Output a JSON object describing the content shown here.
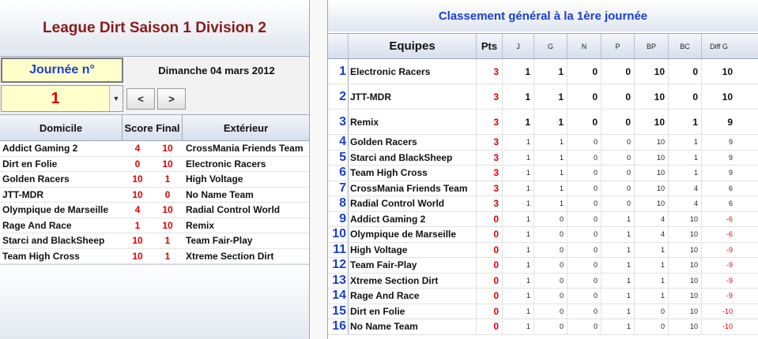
{
  "left": {
    "title": "League Dirt Saison 1 Division 2",
    "journee_label": "Journée n°",
    "date": "Dimanche 04 mars 2012",
    "journee_value": "1",
    "prev_label": "<",
    "next_label": ">",
    "headers": {
      "home": "Domicile",
      "score": "Score Final",
      "away": "Extérieur"
    },
    "matches": [
      {
        "home": "Addict Gaming 2",
        "s1": "4",
        "s2": "10",
        "away": "CrossMania Friends Team"
      },
      {
        "home": "Dirt en Folie",
        "s1": "0",
        "s2": "10",
        "away": "Electronic Racers"
      },
      {
        "home": "Golden Racers",
        "s1": "10",
        "s2": "1",
        "away": "High Voltage"
      },
      {
        "home": "JTT-MDR",
        "s1": "10",
        "s2": "0",
        "away": "No Name Team"
      },
      {
        "home": "Olympique de Marseille",
        "s1": "4",
        "s2": "10",
        "away": "Radial Control World"
      },
      {
        "home": "Rage And Race",
        "s1": "1",
        "s2": "10",
        "away": "Remix"
      },
      {
        "home": "Starci and BlackSheep",
        "s1": "10",
        "s2": "1",
        "away": "Team Fair-Play"
      },
      {
        "home": "Team High Cross",
        "s1": "10",
        "s2": "1",
        "away": "Xtreme Section Dirt"
      }
    ]
  },
  "right": {
    "title": "Classement général à la 1ère journée",
    "headers": {
      "team": "Equipes",
      "pts": "Pts",
      "j": "J",
      "g": "G",
      "n": "N",
      "p": "P",
      "bp": "BP",
      "bc": "BC",
      "diff": "Diff G"
    },
    "rows": [
      {
        "rank": "1",
        "team": "Electronic Racers",
        "pts": "3",
        "j": "1",
        "g": "1",
        "n": "0",
        "p": "0",
        "bp": "10",
        "bc": "0",
        "diff": "10"
      },
      {
        "rank": "2",
        "team": "JTT-MDR",
        "pts": "3",
        "j": "1",
        "g": "1",
        "n": "0",
        "p": "0",
        "bp": "10",
        "bc": "0",
        "diff": "10"
      },
      {
        "rank": "3",
        "team": "Remix",
        "pts": "3",
        "j": "1",
        "g": "1",
        "n": "0",
        "p": "0",
        "bp": "10",
        "bc": "1",
        "diff": "9"
      },
      {
        "rank": "4",
        "team": "Golden Racers",
        "pts": "3",
        "j": "1",
        "g": "1",
        "n": "0",
        "p": "0",
        "bp": "10",
        "bc": "1",
        "diff": "9"
      },
      {
        "rank": "5",
        "team": "Starci and BlackSheep",
        "pts": "3",
        "j": "1",
        "g": "1",
        "n": "0",
        "p": "0",
        "bp": "10",
        "bc": "1",
        "diff": "9"
      },
      {
        "rank": "6",
        "team": "Team High Cross",
        "pts": "3",
        "j": "1",
        "g": "1",
        "n": "0",
        "p": "0",
        "bp": "10",
        "bc": "1",
        "diff": "9"
      },
      {
        "rank": "7",
        "team": "CrossMania Friends Team",
        "pts": "3",
        "j": "1",
        "g": "1",
        "n": "0",
        "p": "0",
        "bp": "10",
        "bc": "4",
        "diff": "6"
      },
      {
        "rank": "8",
        "team": "Radial Control World",
        "pts": "3",
        "j": "1",
        "g": "1",
        "n": "0",
        "p": "0",
        "bp": "10",
        "bc": "4",
        "diff": "6"
      },
      {
        "rank": "9",
        "team": "Addict Gaming 2",
        "pts": "0",
        "j": "1",
        "g": "0",
        "n": "0",
        "p": "1",
        "bp": "4",
        "bc": "10",
        "diff": "-6"
      },
      {
        "rank": "10",
        "team": "Olympique de Marseille",
        "pts": "0",
        "j": "1",
        "g": "0",
        "n": "0",
        "p": "1",
        "bp": "4",
        "bc": "10",
        "diff": "-6"
      },
      {
        "rank": "11",
        "team": "High Voltage",
        "pts": "0",
        "j": "1",
        "g": "0",
        "n": "0",
        "p": "1",
        "bp": "1",
        "bc": "10",
        "diff": "-9"
      },
      {
        "rank": "12",
        "team": "Team Fair-Play",
        "pts": "0",
        "j": "1",
        "g": "0",
        "n": "0",
        "p": "1",
        "bp": "1",
        "bc": "10",
        "diff": "-9"
      },
      {
        "rank": "13",
        "team": "Xtreme Section Dirt",
        "pts": "0",
        "j": "1",
        "g": "0",
        "n": "0",
        "p": "1",
        "bp": "1",
        "bc": "10",
        "diff": "-9"
      },
      {
        "rank": "14",
        "team": "Rage And Race",
        "pts": "0",
        "j": "1",
        "g": "0",
        "n": "0",
        "p": "1",
        "bp": "1",
        "bc": "10",
        "diff": "-9"
      },
      {
        "rank": "15",
        "team": "Dirt en Folie",
        "pts": "0",
        "j": "1",
        "g": "0",
        "n": "0",
        "p": "1",
        "bp": "0",
        "bc": "10",
        "diff": "-10"
      },
      {
        "rank": "16",
        "team": "No Name Team",
        "pts": "0",
        "j": "1",
        "g": "0",
        "n": "0",
        "p": "1",
        "bp": "0",
        "bc": "10",
        "diff": "-10"
      }
    ]
  },
  "colors": {
    "title_red": "#8b1a1a",
    "accent_blue": "#1a3fcf",
    "score_red": "#e00000",
    "select_yellow": "#ffffcc"
  }
}
